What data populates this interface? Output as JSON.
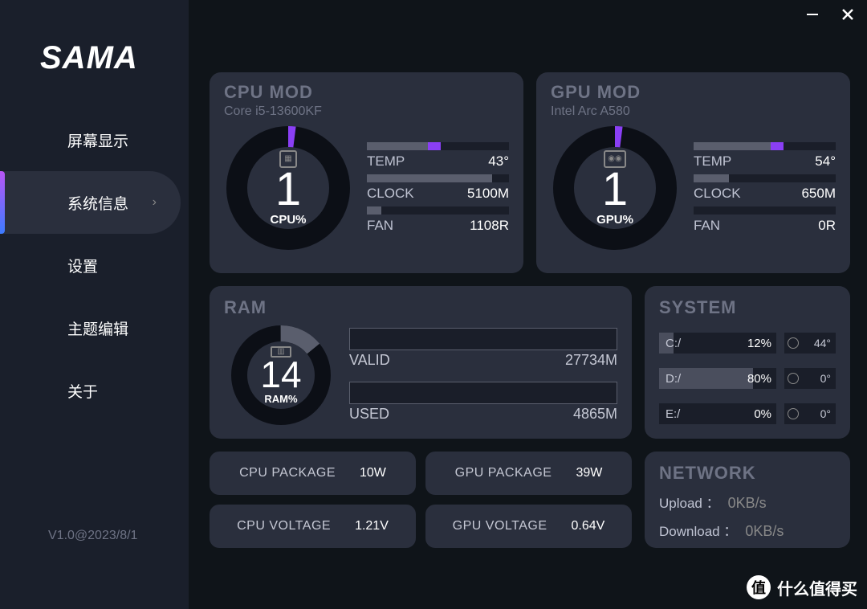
{
  "window": {
    "minimize": "—",
    "close": "✕"
  },
  "sidebar": {
    "logo": "SAMA",
    "items": [
      {
        "label": "屏幕显示",
        "active": false
      },
      {
        "label": "系统信息",
        "active": true
      },
      {
        "label": "设置",
        "active": false
      },
      {
        "label": "主题编辑",
        "active": false
      },
      {
        "label": "关于",
        "active": false
      }
    ],
    "version": "V1.0@2023/8/1"
  },
  "cpu": {
    "title": "CPU MOD",
    "model": "Core i5-13600KF",
    "percent": "1",
    "percent_label": "CPU%",
    "temp_label": "TEMP",
    "temp_val": "43°",
    "clock_label": "CLOCK",
    "clock_val": "5100M",
    "fan_label": "FAN",
    "fan_val": "1108R"
  },
  "gpu": {
    "title": "GPU MOD",
    "model": "Intel Arc A580",
    "percent": "1",
    "percent_label": "GPU%",
    "temp_label": "TEMP",
    "temp_val": "54°",
    "clock_label": "CLOCK",
    "clock_val": "650M",
    "fan_label": "FAN",
    "fan_val": "0R"
  },
  "ram": {
    "title": "RAM",
    "percent": "14",
    "percent_label": "RAM%",
    "valid_label": "VALID",
    "valid_val": "27734M",
    "used_label": "USED",
    "used_val": "4865M"
  },
  "system": {
    "title": "SYSTEM",
    "drives": [
      {
        "name": "C:/",
        "pct": "12%",
        "temp": "44°",
        "fill": 12
      },
      {
        "name": "D:/",
        "pct": "80%",
        "temp": "0°",
        "fill": 80
      },
      {
        "name": "E:/",
        "pct": "0%",
        "temp": "0°",
        "fill": 0
      }
    ]
  },
  "pkg": {
    "cpu_pkg_label": "CPU PACKAGE",
    "cpu_pkg_val": "10W",
    "gpu_pkg_label": "GPU PACKAGE",
    "gpu_pkg_val": "39W",
    "cpu_v_label": "CPU VOLTAGE",
    "cpu_v_val": "1.21V",
    "gpu_v_label": "GPU VOLTAGE",
    "gpu_v_val": "0.64V"
  },
  "network": {
    "title": "NETWORK",
    "up_label": "Upload ：",
    "up_val": "0KB/s",
    "down_label": "Download ：",
    "down_val": "0KB/s"
  },
  "watermark": {
    "badge": "值",
    "text": "什么值得买"
  }
}
